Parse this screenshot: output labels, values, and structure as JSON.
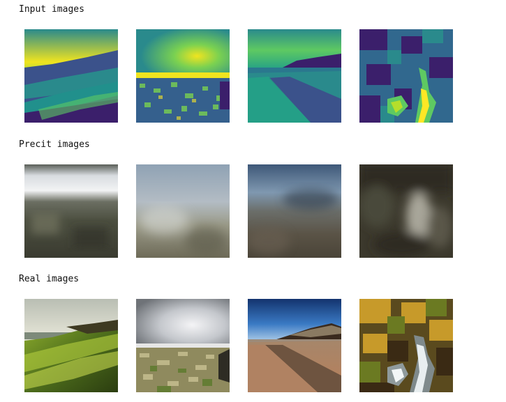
{
  "sections": {
    "input": {
      "title": "Input images"
    },
    "predict": {
      "title": "Precit images"
    },
    "real": {
      "title": "Real images"
    }
  },
  "colors": {
    "background": "#ffffff",
    "text": "#111111",
    "viridis_dark": "#3b1f6b",
    "viridis_mid": "#2a8a8c",
    "viridis_light": "#7ad151",
    "viridis_bright": "#f0e41f"
  }
}
